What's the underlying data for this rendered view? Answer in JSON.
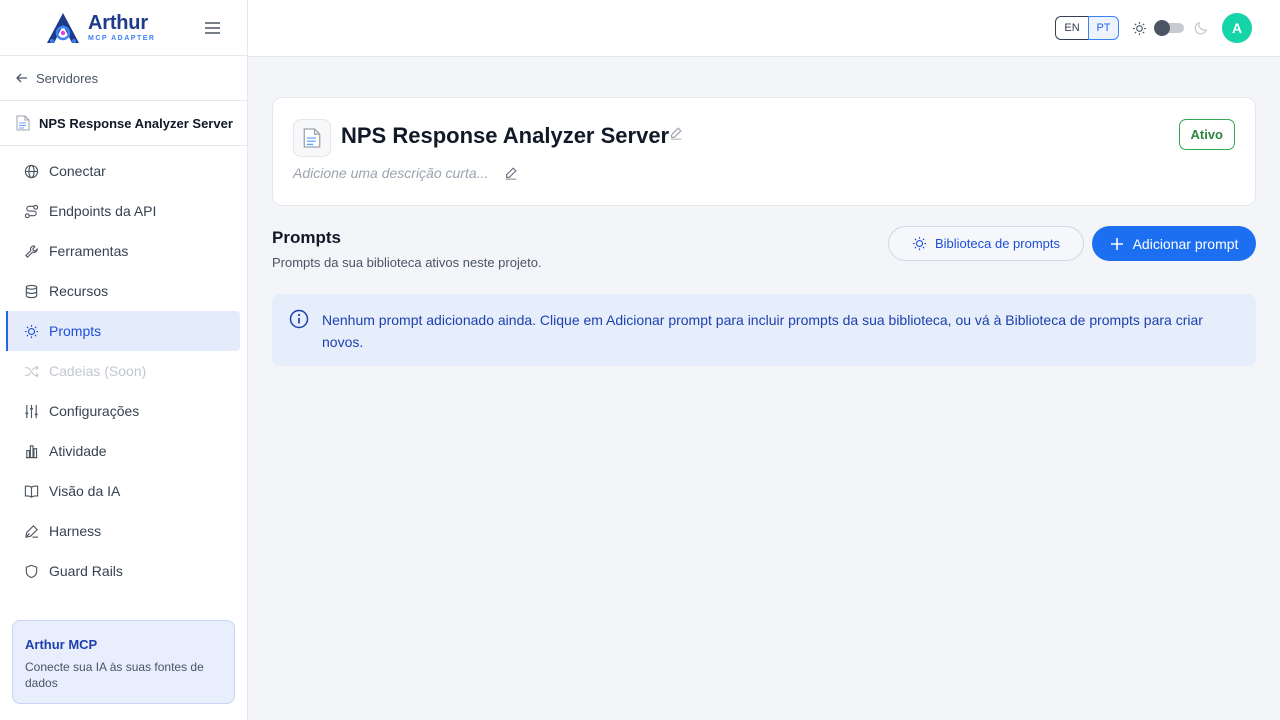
{
  "brand": {
    "name": "Arthur",
    "subtitle": "MCP ADAPTER"
  },
  "sidebar": {
    "back_label": "Servidores",
    "server_name": "NPS Response Analyzer Server",
    "items": [
      {
        "label": "Conectar"
      },
      {
        "label": "Endpoints da API"
      },
      {
        "label": "Ferramentas"
      },
      {
        "label": "Recursos"
      },
      {
        "label": "Prompts"
      },
      {
        "label": "Cadeias (Soon)"
      },
      {
        "label": "Configurações"
      },
      {
        "label": "Atividade"
      },
      {
        "label": "Visão da IA"
      },
      {
        "label": "Harness"
      },
      {
        "label": "Guard Rails"
      }
    ],
    "active_item": "Prompts",
    "promo": {
      "title": "Arthur MCP",
      "text": "Conecte sua IA às suas fontes de dados"
    }
  },
  "header": {
    "languages": [
      "EN",
      "PT"
    ],
    "selected_language": "PT",
    "theme": "light",
    "avatar_initial": "A"
  },
  "server_card": {
    "title": "NPS Response Analyzer Server",
    "description_placeholder": "Adicione uma descrição curta...",
    "status": "Ativo"
  },
  "prompts_section": {
    "title": "Prompts",
    "subtitle": "Prompts da sua biblioteca ativos neste projeto.",
    "library_button": "Biblioteca de prompts",
    "add_button": "Adicionar prompt",
    "empty_message": "Nenhum prompt adicionado ainda. Clique em Adicionar prompt para incluir prompts da sua biblioteca, ou vá à Biblioteca de prompts para criar novos."
  },
  "colors": {
    "primary": "#1d6ff2",
    "status_green": "#2e8540",
    "avatar": "#14d4a8",
    "info_bg": "#e6eefc"
  }
}
